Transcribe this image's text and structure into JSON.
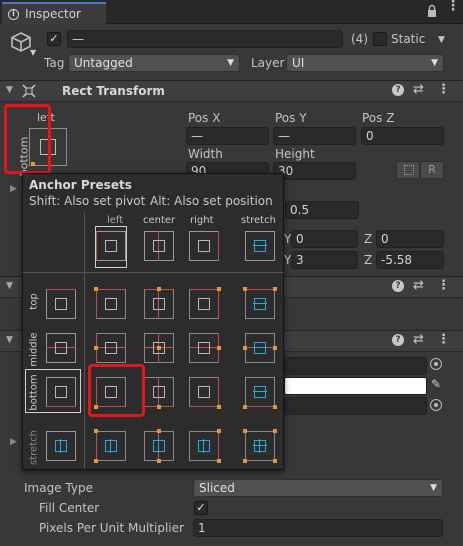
{
  "tab": {
    "title": "Inspector"
  },
  "object": {
    "name": "—",
    "count": "(4)",
    "static_label": "Static",
    "tag_label": "Tag",
    "tag_value": "Untagged",
    "layer_label": "Layer",
    "layer_value": "UI"
  },
  "rect_transform": {
    "title": "Rect Transform",
    "anchor_h": "left",
    "anchor_v": "bottom",
    "pos_x_label": "Pos X",
    "pos_y_label": "Pos Y",
    "pos_z_label": "Pos Z",
    "pos_x": "—",
    "pos_y": "—",
    "pos_z": "0",
    "width_label": "Width",
    "height_label": "Height",
    "width": "90",
    "height": "30",
    "r_button": "R",
    "pivot_y": "0.5",
    "rot_y_label": "Y",
    "rot_y": "0",
    "rot_z_label": "Z",
    "rot_z": "0",
    "scale_y_label": "Y",
    "scale_y": "3",
    "scale_z_label": "Z",
    "scale_z": "-5.58"
  },
  "popup": {
    "title": "Anchor Presets",
    "hint_shift": "Shift: Also set pivot",
    "hint_alt": "Alt: Also set position",
    "col_labels": [
      "left",
      "center",
      "right",
      "stretch"
    ],
    "row_labels": [
      "top",
      "middle",
      "bottom",
      "stretch"
    ]
  },
  "image": {
    "type_label": "Image Type",
    "type_value": "Sliced",
    "fill_center_label": "Fill Center",
    "fill_center_check": "✓",
    "ppu_label": "Pixels Per Unit Multiplier",
    "ppu_value": "1"
  }
}
